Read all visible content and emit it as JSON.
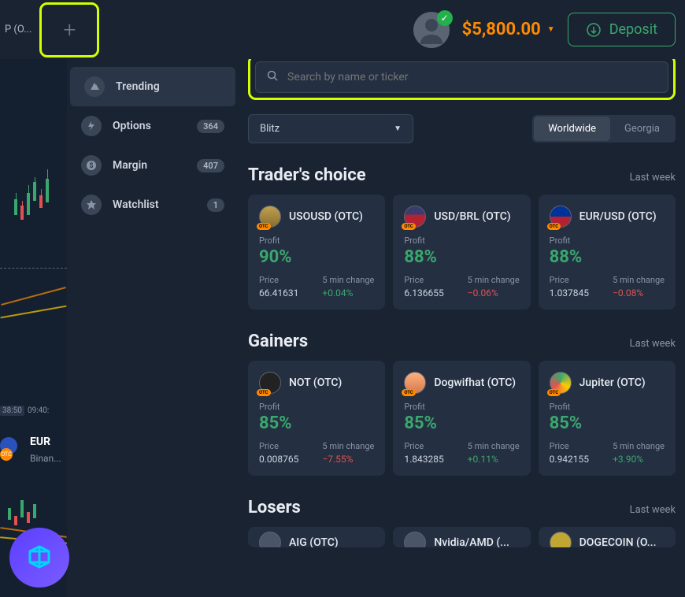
{
  "header": {
    "ticker_fragment": "P (O...",
    "balance": "$5,800.00",
    "deposit_label": "Deposit"
  },
  "sidebar": {
    "items": [
      {
        "label": "Trending",
        "count": null
      },
      {
        "label": "Options",
        "count": "364"
      },
      {
        "label": "Margin",
        "count": "407"
      },
      {
        "label": "Watchlist",
        "count": "1"
      }
    ]
  },
  "search": {
    "placeholder": "Search by name or ticker"
  },
  "filters": {
    "mode": "Blitz",
    "regions": [
      "Worldwide",
      "Georgia"
    ],
    "active_region": 0
  },
  "sections": [
    {
      "title": "Trader's choice",
      "subtitle": "Last week",
      "cards": [
        {
          "name": "USOUSD (OTC)",
          "profit": "90%",
          "price": "66.41631",
          "change": "+0.04%",
          "dir": "pos",
          "flag": "us-oil"
        },
        {
          "name": "USD/BRL (OTC)",
          "profit": "88%",
          "price": "6.136655",
          "change": "−0.06%",
          "dir": "neg",
          "flag": "usd-brl"
        },
        {
          "name": "EUR/USD (OTC)",
          "profit": "88%",
          "price": "1.037845",
          "change": "−0.08%",
          "dir": "neg",
          "flag": "eur-usd"
        }
      ]
    },
    {
      "title": "Gainers",
      "subtitle": "Last week",
      "cards": [
        {
          "name": "NOT (OTC)",
          "profit": "85%",
          "price": "0.008765",
          "change": "−7.55%",
          "dir": "neg",
          "flag": "not"
        },
        {
          "name": "Dogwifhat (OTC)",
          "profit": "85%",
          "price": "1.843285",
          "change": "+0.11%",
          "dir": "pos",
          "flag": "wif"
        },
        {
          "name": "Jupiter (OTC)",
          "profit": "85%",
          "price": "0.942155",
          "change": "+3.90%",
          "dir": "pos",
          "flag": "jup"
        }
      ]
    },
    {
      "title": "Losers",
      "subtitle": "Last week",
      "cards": [
        {
          "name": "AIG (OTC)",
          "profit": "",
          "price": "",
          "change": "",
          "dir": "",
          "flag": "aig"
        },
        {
          "name": "Nvidia/AMD (...",
          "profit": "",
          "price": "",
          "change": "",
          "dir": "",
          "flag": "nvda"
        },
        {
          "name": "DOGECOIN (O...",
          "profit": "",
          "price": "",
          "change": "",
          "dir": "",
          "flag": "doge"
        }
      ]
    }
  ],
  "chart": {
    "time1": "38:50",
    "time2": "09:40:",
    "pair": "EUR",
    "sub": "Binan..."
  },
  "labels": {
    "profit": "Profit",
    "price": "Price",
    "change": "5 min change"
  }
}
